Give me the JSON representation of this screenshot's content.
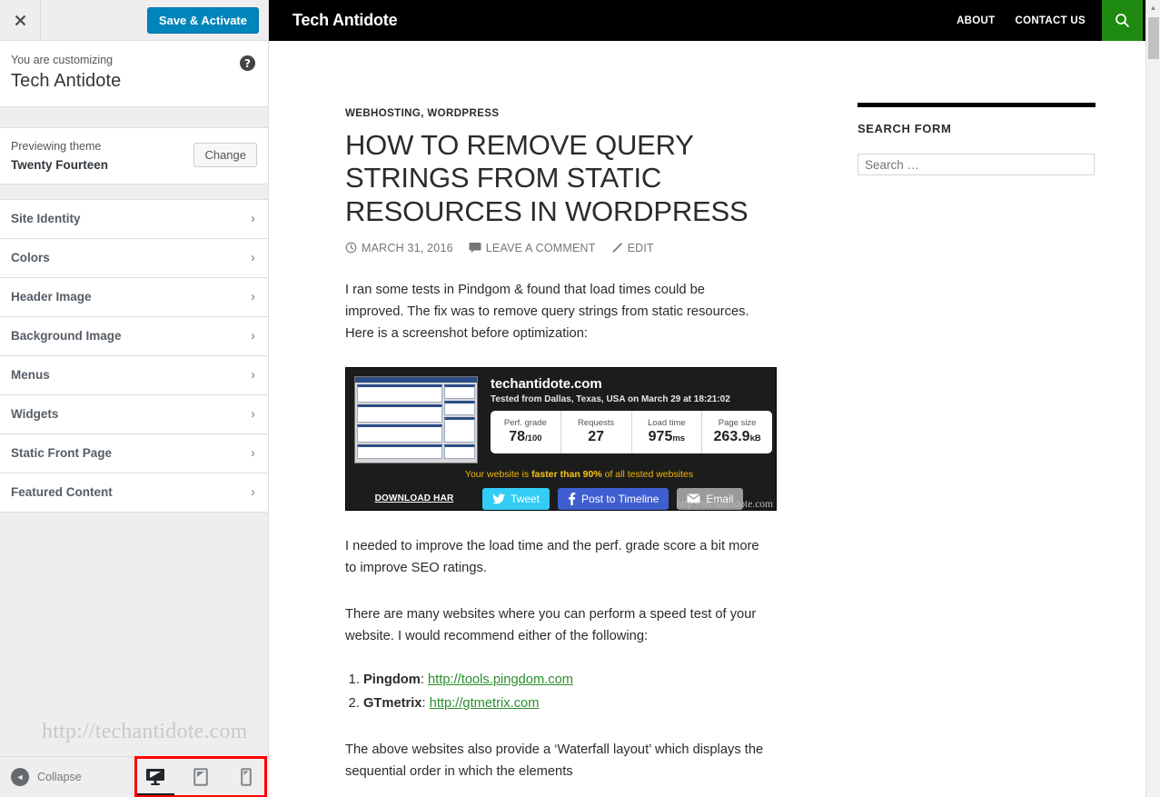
{
  "customizer": {
    "close_label": "×",
    "save_label": "Save & Activate",
    "customizing_label": "You are customizing",
    "site_name": "Tech Antidote",
    "help_label": "?",
    "previewing_label": "Previewing theme",
    "theme_name": "Twenty Fourteen",
    "change_label": "Change",
    "items": [
      {
        "label": "Site Identity"
      },
      {
        "label": "Colors"
      },
      {
        "label": "Header Image"
      },
      {
        "label": "Background Image"
      },
      {
        "label": "Menus"
      },
      {
        "label": "Widgets"
      },
      {
        "label": "Static Front Page"
      },
      {
        "label": "Featured Content"
      }
    ],
    "watermark": "http://techantidote.com",
    "collapse_label": "Collapse",
    "devices": [
      {
        "name": "desktop",
        "active": true
      },
      {
        "name": "tablet",
        "active": false
      },
      {
        "name": "mobile",
        "active": false
      }
    ],
    "accent_save": "#0085ba",
    "highlight_color": "#ff0000"
  },
  "site": {
    "title": "Tech Antidote",
    "nav": [
      {
        "label": "ABOUT"
      },
      {
        "label": "CONTACT US"
      }
    ],
    "search_button_color": "#1e8a0f"
  },
  "post": {
    "categories": "WEBHOSTING, WORDPRESS",
    "title": "HOW TO REMOVE QUERY STRINGS FROM STATIC RESOURCES IN WORDPRESS",
    "date": "MARCH 31, 2016",
    "comments": "LEAVE A COMMENT",
    "edit": "EDIT",
    "para1": "I ran some tests in Pindgom & found that load times could be improved. The fix was to remove query strings from static resources. Here is a screenshot before optimization:",
    "para2": "I needed to improve the load time and the perf. grade score a bit more to improve SEO ratings.",
    "para3": "There are many websites where you can perform a speed test of your website. I would recommend either of the following:",
    "list": [
      {
        "name": "Pingdom",
        "sep": ": ",
        "url": "http://tools.pingdom.com"
      },
      {
        "name": "GTmetrix",
        "sep": ": ",
        "url": "http://gtmetrix.com"
      }
    ],
    "para4": "The above websites also provide a ‘Waterfall layout’ which displays the sequential order in which the elements"
  },
  "pingdom": {
    "domain": "techantidote.com",
    "tested": "Tested from Dallas, Texas, USA on March 29 at 18:21:02",
    "stats": [
      {
        "label": "Perf. grade",
        "value": "78",
        "unit": "/100"
      },
      {
        "label": "Requests",
        "value": "27",
        "unit": ""
      },
      {
        "label": "Load time",
        "value": "975",
        "unit": "ms"
      },
      {
        "label": "Page size",
        "value": "263.9",
        "unit": "kB"
      }
    ],
    "faster_pre": "Your website is ",
    "faster_strong": "faster than 90%",
    "faster_post": " of all tested websites",
    "download_har": "DOWNLOAD HAR",
    "tweet": "Tweet",
    "facebook": "Post to Timeline",
    "email": "Email",
    "watermark": "http://techantidote.com"
  },
  "widget": {
    "title": "SEARCH FORM",
    "search_placeholder": "Search …",
    "search_value": ""
  }
}
